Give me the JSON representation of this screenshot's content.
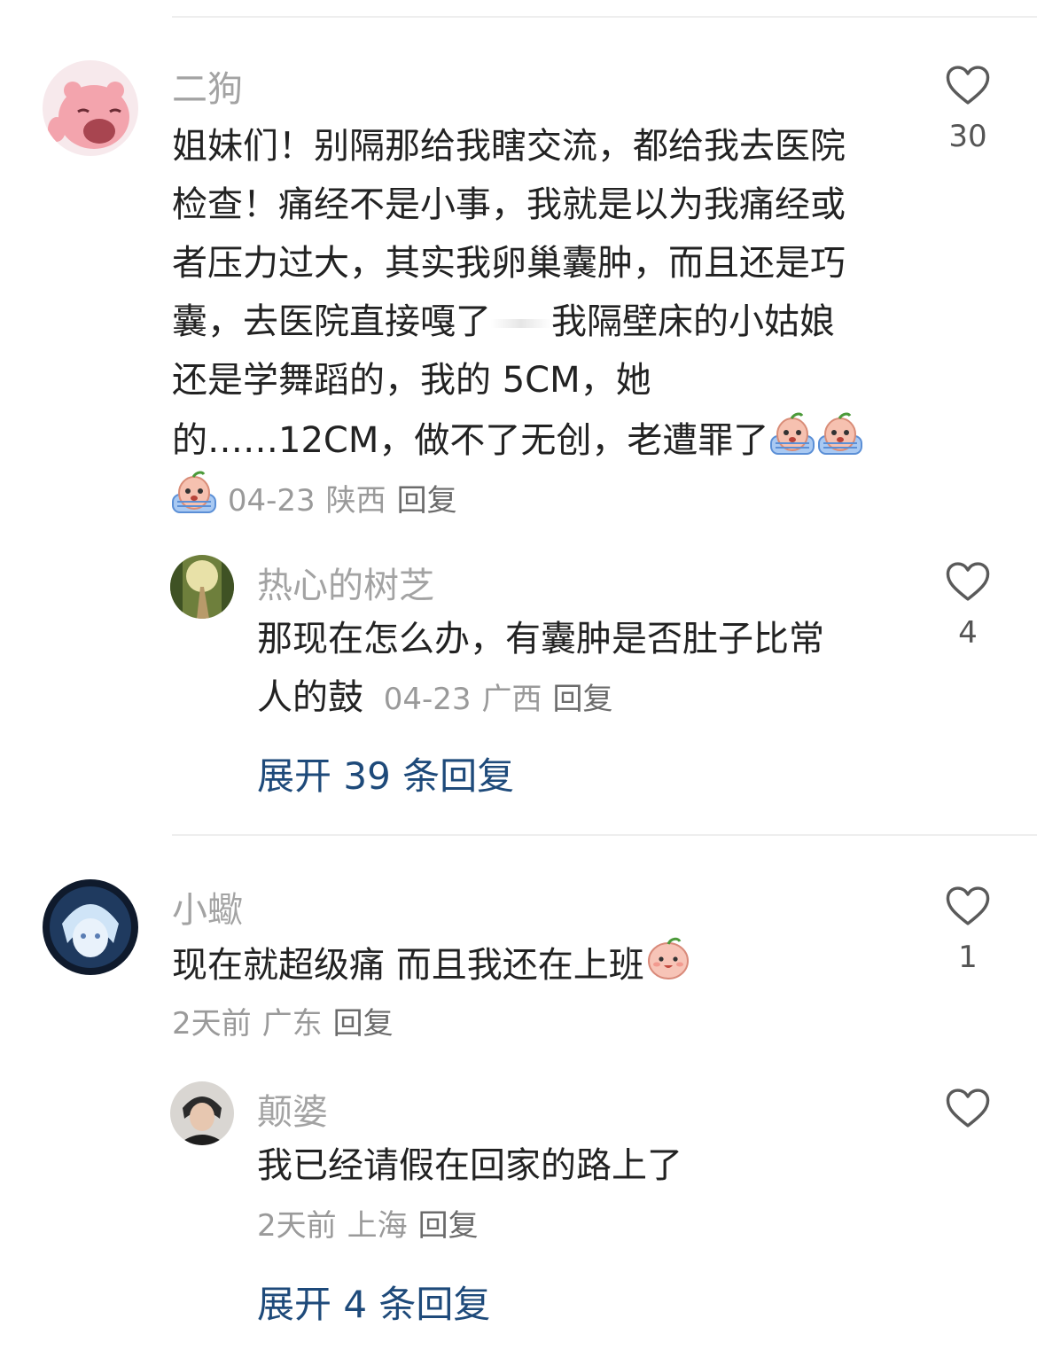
{
  "comments": [
    {
      "name": "二狗",
      "text_lines": [
        "姐妹们！别隔那给我瞎交流，都给我去医院",
        "检查！痛经不是小事，我就是以为我痛经或",
        "者压力过大，其实我卵巢囊肿，而且还是巧",
        "囊，去医院直接嘎了",
        "我隔壁床的小姑娘",
        "还是学舞蹈的，我的 5CM，她",
        "的……12CM，做不了无创，老遭罪了"
      ],
      "date": "04-23",
      "location": "陕西",
      "reply_label": "回复",
      "likes": "30",
      "replies": [
        {
          "name": "热心的树芝",
          "text_lines": [
            "那现在怎么办，有囊肿是否肚子比常",
            "人的鼓"
          ],
          "date": "04-23",
          "location": "广西",
          "reply_label": "回复",
          "likes": "4"
        }
      ],
      "expand_label": "展开 39 条回复"
    },
    {
      "name": "小蠍",
      "text_lines": [
        "现在就超级痛 而且我还在上班"
      ],
      "date": "2天前",
      "location": "广东",
      "reply_label": "回复",
      "likes": "1",
      "replies": [
        {
          "name": "颠婆",
          "text_lines": [
            "我已经请假在回家的路上了"
          ],
          "date": "2天前",
          "location": "上海",
          "reply_label": "回复",
          "likes": ""
        }
      ],
      "expand_label": "展开 4 条回复"
    }
  ],
  "icons": {
    "like": "heart-outline-icon",
    "emoji_cry": "crying-peach-emoji-icon",
    "emoji_smile": "smiling-peach-emoji-icon"
  },
  "colors": {
    "link": "#1e4a7a",
    "meta": "#9a9a9a",
    "name": "#a3a3a3"
  }
}
